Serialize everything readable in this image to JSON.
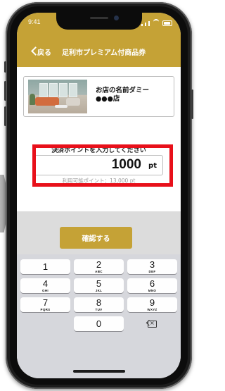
{
  "status_bar": {
    "time": "9:41"
  },
  "nav": {
    "back_label": "戻る",
    "title": "足利市プレミアム付商品券"
  },
  "shop": {
    "name_line1": "お店の名前ダミー",
    "name_line2": "●●●店"
  },
  "points_input": {
    "label": "決済ポイントを入力してください",
    "value": "1000",
    "unit": "pt",
    "available": "利用可能ポイント：13,000 pt"
  },
  "confirm_button": {
    "label": "確認する"
  },
  "keypad": {
    "keys": [
      {
        "digit": "1",
        "letters": ""
      },
      {
        "digit": "2",
        "letters": "ABC"
      },
      {
        "digit": "3",
        "letters": "DEF"
      },
      {
        "digit": "4",
        "letters": "GHI"
      },
      {
        "digit": "5",
        "letters": "JKL"
      },
      {
        "digit": "6",
        "letters": "MNO"
      },
      {
        "digit": "7",
        "letters": "PQRS"
      },
      {
        "digit": "8",
        "letters": "TUV"
      },
      {
        "digit": "9",
        "letters": "WXYZ"
      },
      {
        "digit": "0",
        "letters": ""
      }
    ],
    "delete_icon": "backspace-icon"
  },
  "colors": {
    "brand_gold": "#c5a236",
    "highlight_red": "#e8101a"
  }
}
